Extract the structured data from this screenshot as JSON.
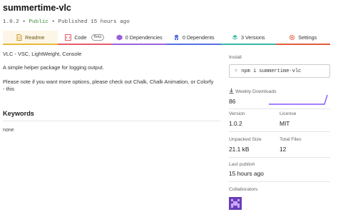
{
  "package": {
    "name": "summertime-vlc",
    "version": "1.0.2",
    "visibility": "Public",
    "published": "Published 15 hours ago",
    "sep": "•"
  },
  "tabs": [
    {
      "label": "Readme",
      "icon": "file-icon",
      "color": "#e8b93a"
    },
    {
      "label": "Code",
      "icon": "code-icon",
      "badge": "Beta",
      "color": "#e85a6b"
    },
    {
      "label": "0 Dependencies",
      "icon": "box-icon",
      "color": "#9b5fdc"
    },
    {
      "label": "0 Dependents",
      "icon": "boxes-icon",
      "color": "#5570e0"
    },
    {
      "label": "3 Versions",
      "icon": "tag-icon",
      "color": "#3ab6a8"
    },
    {
      "label": "Settings",
      "icon": "gear-icon",
      "color": "#e25a3a"
    }
  ],
  "readme": {
    "line1": "VLC - VSC, LightWeight, Console",
    "line2": "A simple helper package for logging output.",
    "line3a": "Please note if you want more options, please check out Chalk, Chalk Animation, or Colorfy",
    "line3b": "- this"
  },
  "keywords": {
    "heading": "Keywords",
    "value": "none"
  },
  "sidebar": {
    "install_label": "Install",
    "install_command": "npm i summertime-vlc",
    "install_prompt": ">",
    "downloads_label": "Weekly Downloads",
    "downloads_value": "86",
    "version_label": "Version",
    "version_value": "1.0.2",
    "license_label": "License",
    "license_value": "MIT",
    "unpacked_label": "Unpacked Size",
    "unpacked_value": "21.1 kB",
    "files_label": "Total Files",
    "files_value": "12",
    "last_publish_label": "Last publish",
    "last_publish_value": "15 hours ago",
    "collaborators_label": "Collaborators"
  },
  "colors": {
    "accent_readme": "#e8b93a",
    "sparkline": "#8956ff",
    "avatar": "#6a3fb8"
  }
}
